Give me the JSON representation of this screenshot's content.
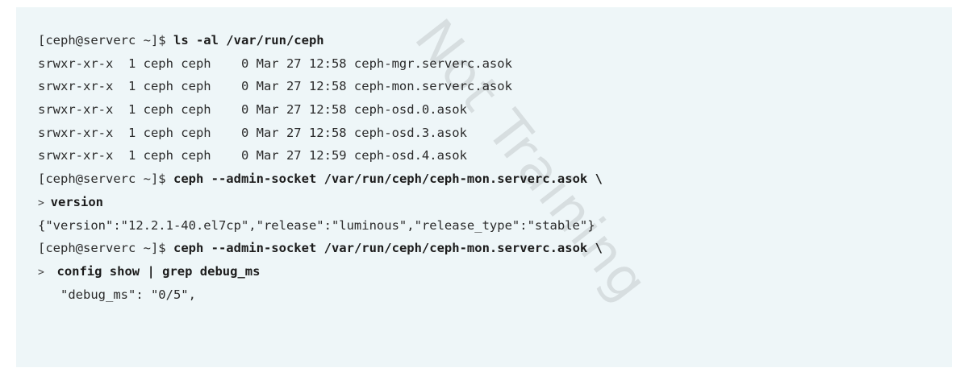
{
  "terminal": {
    "watermark": "Not Training",
    "lines": [
      {
        "prompt": "[ceph@serverc ~]$ ",
        "text": "ls -al /var/run/ceph"
      },
      {
        "text": "srwxr-xr-x  1 ceph ceph    0 Mar 27 12:58 ceph-mgr.serverc.asok"
      },
      {
        "text": "srwxr-xr-x  1 ceph ceph    0 Mar 27 12:58 ceph-mon.serverc.asok"
      },
      {
        "text": "srwxr-xr-x  1 ceph ceph    0 Mar 27 12:58 ceph-osd.0.asok"
      },
      {
        "text": "srwxr-xr-x  1 ceph ceph    0 Mar 27 12:58 ceph-osd.3.asok"
      },
      {
        "text": "srwxr-xr-x  1 ceph ceph    0 Mar 27 12:59 ceph-osd.4.asok"
      },
      {
        "prompt": "[ceph@serverc ~]$ ",
        "text": "ceph --admin-socket /var/run/ceph/ceph-mon.serverc.asok \\"
      },
      {
        "prompt": "> ",
        "text": "version"
      },
      {
        "text": "{\"version\":\"12.2.1-40.el7cp\",\"release\":\"luminous\",\"release_type\":\"stable\"}"
      },
      {
        "prompt": "[ceph@serverc ~]$ ",
        "text": "ceph --admin-socket /var/run/ceph/ceph-mon.serverc.asok \\"
      },
      {
        "prompt": ">  ",
        "text": "config show | grep debug_ms"
      },
      {
        "text": "   \"debug_ms\": \"0/5\","
      }
    ]
  }
}
